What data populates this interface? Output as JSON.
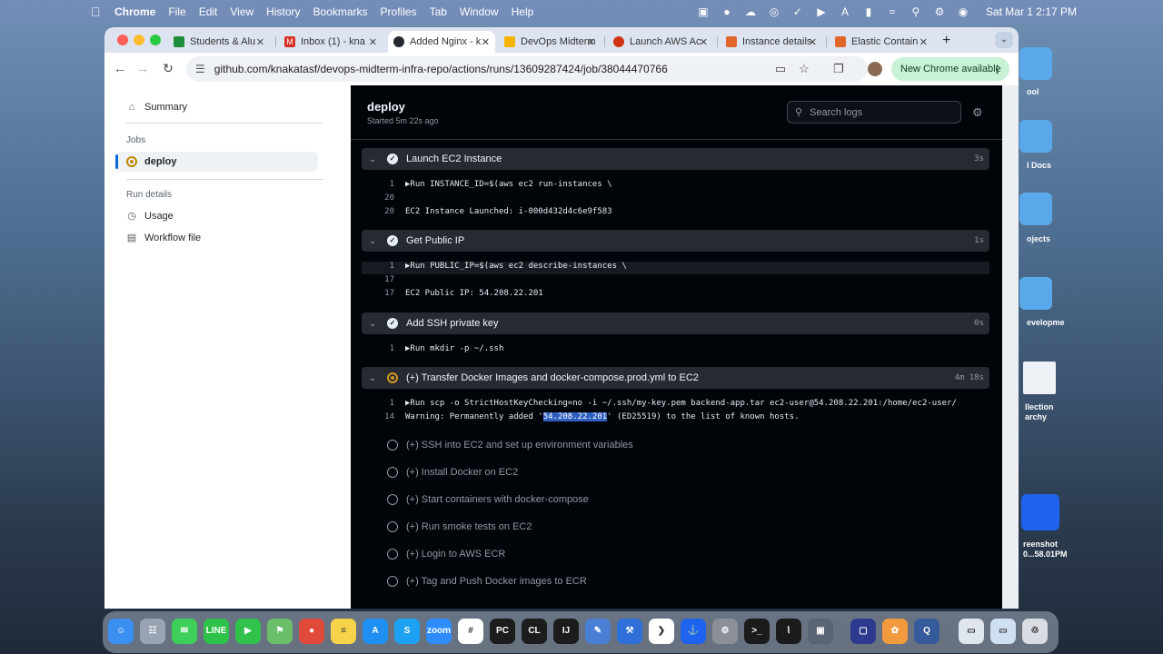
{
  "menubar": {
    "app": "Chrome",
    "items": [
      "File",
      "Edit",
      "View",
      "History",
      "Bookmarks",
      "Profiles",
      "Tab",
      "Window",
      "Help"
    ],
    "clock": "Sat Mar 1  2:17 PM"
  },
  "desktop": {
    "labels": [
      "ool",
      "l Docs",
      "ojects",
      "evelopme",
      "llection\narchy",
      "reenshot\n0...58.01PM"
    ]
  },
  "browser": {
    "tabs": [
      {
        "label": "Students & Alu",
        "icon": "google-classroom-icon",
        "color": "#1e8e3e"
      },
      {
        "label": "Inbox (1) - kna",
        "icon": "gmail-icon",
        "color": "#d93025"
      },
      {
        "label": "Added Nginx - k",
        "icon": "github-icon",
        "color": "#24292f"
      },
      {
        "label": "DevOps Midterm",
        "icon": "google-docs-icon",
        "color": "#f4b400"
      },
      {
        "label": "Launch AWS Ac",
        "icon": "aws-icon",
        "color": "#d13212"
      },
      {
        "label": "Instance details",
        "icon": "aws-icon",
        "color": "#e0662b"
      },
      {
        "label": "Elastic Contain",
        "icon": "aws-icon",
        "color": "#e0662b"
      }
    ],
    "url": "github.com/knakatasf/devops-midterm-infra-repo/actions/runs/13609287424/job/38044470766",
    "update_button": "New Chrome available"
  },
  "sidebar": {
    "summary": "Summary",
    "jobs_heading": "Jobs",
    "job": "deploy",
    "run_details_heading": "Run details",
    "usage": "Usage",
    "workflow_file": "Workflow file"
  },
  "log": {
    "title": "deploy",
    "subtitle": "Started 5m 22s ago",
    "search_placeholder": "Search logs",
    "steps": [
      {
        "name": "Launch EC2 Instance",
        "duration": "3s",
        "lines": [
          {
            "n": "1",
            "t": "▶Run INSTANCE_ID=$(aws ec2 run-instances \\"
          },
          {
            "n": "20",
            "t": ""
          },
          {
            "n": "20",
            "t": "EC2 Instance Launched: i-000d432d4c6e9f583"
          }
        ]
      },
      {
        "name": "Get Public IP",
        "duration": "1s",
        "lines": [
          {
            "n": "1",
            "t": "▶Run PUBLIC_IP=$(aws ec2 describe-instances \\"
          },
          {
            "n": "17",
            "t": ""
          },
          {
            "n": "17",
            "t": "EC2 Public IP: 54.208.22.201"
          }
        ]
      },
      {
        "name": "Add SSH private key",
        "duration": "0s",
        "lines": [
          {
            "n": "1",
            "t": "▶Run mkdir -p ~/.ssh"
          }
        ]
      },
      {
        "name": "(+) Transfer Docker Images and docker-compose.prod.yml to EC2",
        "duration": "4m 18s",
        "lines": [
          {
            "n": "1",
            "t": "▶Run scp -o StrictHostKeyChecking=no -i ~/.ssh/my-key.pem backend-app.tar ec2-user@54.208.22.201:/home/ec2-user/"
          },
          {
            "n": "14",
            "pre": "Warning: Permanently added '",
            "sel": "54.208.22.201",
            "post": "' (ED25519) to the list of known hosts."
          }
        ]
      }
    ],
    "queued_steps": [
      "(+) SSH into EC2 and set up environment variables",
      "(+) Install Docker on EC2",
      "(+) Start containers with docker-compose",
      "(+) Run smoke tests on EC2",
      "(+) Login to AWS ECR",
      "(+) Tag and Push Docker images to ECR"
    ]
  },
  "dock": {
    "apps": [
      {
        "name": "finder",
        "color": "#3b8ff0",
        "glyph": "☺"
      },
      {
        "name": "launchpad",
        "color": "#9aa3b4",
        "glyph": "☷"
      },
      {
        "name": "messages",
        "color": "#3ecf5a",
        "glyph": "✉"
      },
      {
        "name": "line",
        "color": "#2fc24a",
        "glyph": "LINE"
      },
      {
        "name": "facetime",
        "color": "#31c24b",
        "glyph": "▶"
      },
      {
        "name": "maps",
        "color": "#6bbf6a",
        "glyph": "⚑"
      },
      {
        "name": "chrome",
        "color": "#e04a3a",
        "glyph": "●"
      },
      {
        "name": "notes",
        "color": "#f6d34a",
        "glyph": "≡"
      },
      {
        "name": "app-store",
        "color": "#1f8ff1",
        "glyph": "A"
      },
      {
        "name": "skype",
        "color": "#1da1f2",
        "glyph": "S"
      },
      {
        "name": "zoom",
        "color": "#2d8cff",
        "glyph": "zoom"
      },
      {
        "name": "slack",
        "color": "#ffffff",
        "glyph": "#"
      },
      {
        "name": "pycharm",
        "color": "#1c1c1c",
        "glyph": "PC"
      },
      {
        "name": "clion",
        "color": "#1c1c1c",
        "glyph": "CL"
      },
      {
        "name": "intellij",
        "color": "#1c1c1c",
        "glyph": "IJ"
      },
      {
        "name": "xcode-tools",
        "color": "#4a7fd6",
        "glyph": "✎"
      },
      {
        "name": "xcode",
        "color": "#2e6fd8",
        "glyph": "⚒"
      },
      {
        "name": "vscode",
        "color": "#ffffff",
        "glyph": "❯"
      },
      {
        "name": "docker",
        "color": "#1d63ed",
        "glyph": "⚓"
      },
      {
        "name": "system-settings",
        "color": "#8a8f98",
        "glyph": "⚙"
      },
      {
        "name": "terminal",
        "color": "#1b1b1b",
        "glyph": ">_"
      },
      {
        "name": "voice-memos",
        "color": "#1b1b1b",
        "glyph": "⌇"
      },
      {
        "name": "screenshot",
        "color": "#5a6474",
        "glyph": "▣"
      },
      {
        "name": "screen-share",
        "color": "#2d3a8f",
        "glyph": "▢"
      },
      {
        "name": "photos",
        "color": "#f19a3e",
        "glyph": "✿"
      },
      {
        "name": "quicktime",
        "color": "#355b9a",
        "glyph": "Q"
      },
      {
        "name": "downloads",
        "color": "#dfe6ee",
        "glyph": "▭"
      },
      {
        "name": "documents",
        "color": "#cfe0f2",
        "glyph": "▭"
      },
      {
        "name": "trash",
        "color": "#d9dde3",
        "glyph": "♲"
      }
    ]
  }
}
